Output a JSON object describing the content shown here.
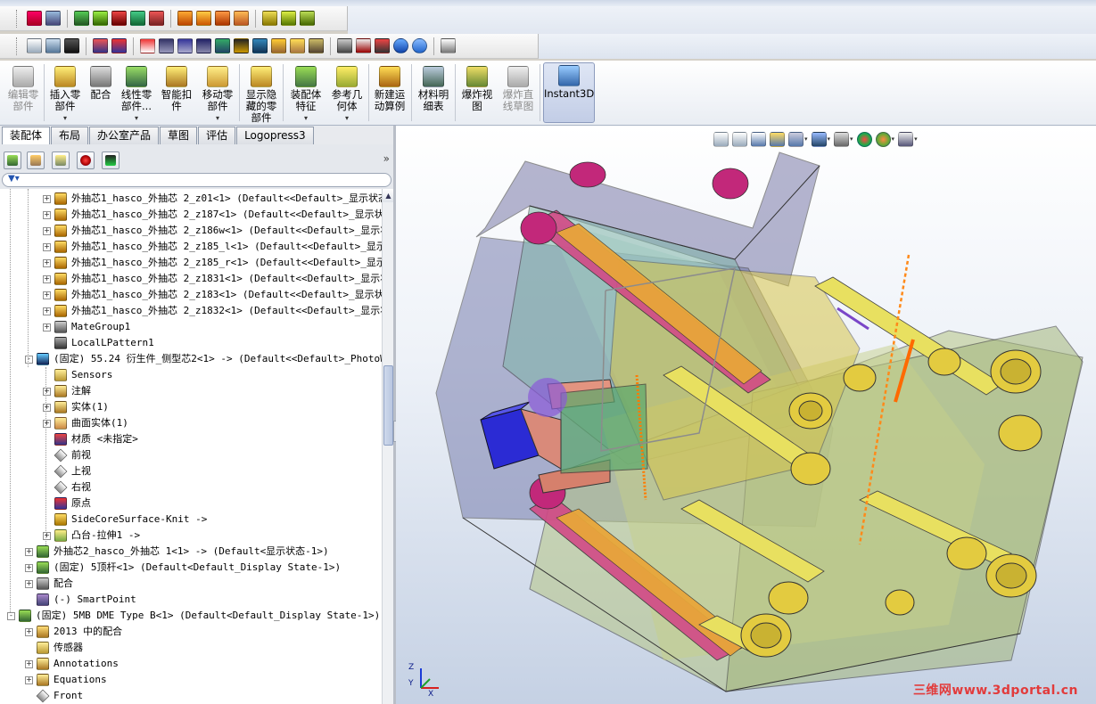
{
  "command_manager": {
    "buttons": [
      {
        "label_lines": [
          "编辑零",
          "部件"
        ],
        "disabled": true
      },
      {
        "label_lines": [
          "插入零",
          "部件"
        ],
        "dropdown": true
      },
      {
        "label_lines": [
          "配合"
        ]
      },
      {
        "label_lines": [
          "线性零",
          "部件..."
        ],
        "dropdown": true
      },
      {
        "label_lines": [
          "智能扣",
          "件"
        ]
      },
      {
        "label_lines": [
          "移动零",
          "部件"
        ],
        "dropdown": true
      },
      {
        "label_lines": [
          "显示隐",
          "藏的零",
          "部件"
        ]
      },
      {
        "label_lines": [
          "装配体",
          "特征"
        ],
        "dropdown": true
      },
      {
        "label_lines": [
          "参考几",
          "何体"
        ],
        "dropdown": true
      },
      {
        "label_lines": [
          "新建运",
          "动算例"
        ]
      },
      {
        "label_lines": [
          "材料明",
          "细表"
        ]
      },
      {
        "label_lines": [
          "爆炸视",
          "图"
        ]
      },
      {
        "label_lines": [
          "爆炸直",
          "线草图"
        ],
        "disabled": true
      },
      {
        "label_lines": [
          "Instant3D"
        ],
        "active": true
      }
    ]
  },
  "tabs": [
    "装配体",
    "布局",
    "办公室产品",
    "草图",
    "评估",
    "Logopress3"
  ],
  "active_tab": "装配体",
  "tree": {
    "rows": [
      {
        "text": "外抽芯1_hasco_外抽芯 2_z01<1> (Default<<Default>_显示状态",
        "level": 3,
        "expand": "+",
        "icon": "part-icon"
      },
      {
        "text": "外抽芯1_hasco_外抽芯 2_z187<1> (Default<<Default>_显示状态",
        "level": 3,
        "expand": "+",
        "icon": "part-icon"
      },
      {
        "text": "外抽芯1_hasco_外抽芯 2_z186w<1> (Default<<Default>_显示状态",
        "level": 3,
        "expand": "+",
        "icon": "part-icon"
      },
      {
        "text": "外抽芯1_hasco_外抽芯 2_z185_l<1> (Default<<Default>_显示状",
        "level": 3,
        "expand": "+",
        "icon": "part-icon"
      },
      {
        "text": "外抽芯1_hasco_外抽芯 2_z185_r<1> (Default<<Default>_显示状",
        "level": 3,
        "expand": "+",
        "icon": "part-icon"
      },
      {
        "text": "外抽芯1_hasco_外抽芯 2_z1831<1> (Default<<Default>_显示状态",
        "level": 3,
        "expand": "+",
        "icon": "part-icon"
      },
      {
        "text": "外抽芯1_hasco_外抽芯 2_z183<1> (Default<<Default>_显示状态",
        "level": 3,
        "expand": "+",
        "icon": "part-icon"
      },
      {
        "text": "外抽芯1_hasco_外抽芯 2_z1832<1> (Default<<Default>_显示状",
        "level": 3,
        "expand": "+",
        "icon": "part-icon"
      },
      {
        "text": "MateGroup1",
        "level": 3,
        "expand": "+",
        "icon": "mate-icon"
      },
      {
        "text": "LocalLPattern1",
        "level": 3,
        "expand": "",
        "icon": "pattern-icon"
      },
      {
        "text": "(固定) 55.24 衍生件_侧型芯2<1> -> (Default<<Default>_PhotoWor",
        "level": 2,
        "expand": "-",
        "icon": "derived-part-icon"
      },
      {
        "text": "Sensors",
        "level": 3,
        "expand": "",
        "icon": "sensor-icon"
      },
      {
        "text": "注解",
        "level": 3,
        "expand": "+",
        "icon": "annotation-icon"
      },
      {
        "text": "实体(1)",
        "level": 3,
        "expand": "+",
        "icon": "solid-body-icon"
      },
      {
        "text": "曲面实体(1)",
        "level": 3,
        "expand": "+",
        "icon": "surface-body-icon"
      },
      {
        "text": "材质 <未指定>",
        "level": 3,
        "expand": "",
        "icon": "material-icon"
      },
      {
        "text": "前视",
        "level": 3,
        "expand": "",
        "icon": "plane-icon"
      },
      {
        "text": "上视",
        "level": 3,
        "expand": "",
        "icon": "plane-icon"
      },
      {
        "text": "右视",
        "level": 3,
        "expand": "",
        "icon": "plane-icon"
      },
      {
        "text": "原点",
        "level": 3,
        "expand": "",
        "icon": "origin-icon"
      },
      {
        "text": "SideCoreSurface-Knit ->",
        "level": 3,
        "expand": "",
        "icon": "knit-icon"
      },
      {
        "text": "凸台-拉伸1 ->",
        "level": 3,
        "expand": "+",
        "icon": "extrude-icon"
      },
      {
        "text": "外抽芯2_hasco_外抽芯 1<1> -> (Default<显示状态-1>)",
        "level": 2,
        "expand": "+",
        "icon": "assembly-icon"
      },
      {
        "text": "(固定) 5顶杆<1> (Default<Default_Display State-1>)",
        "level": 2,
        "expand": "+",
        "icon": "assembly-icon"
      },
      {
        "text": "配合",
        "level": 2,
        "expand": "+",
        "icon": "mate-icon"
      },
      {
        "text": "(-) SmartPoint",
        "level": 2,
        "expand": "",
        "icon": "smartpoint-icon"
      },
      {
        "text": "(固定) 5MB DME Type B<1> (Default<Default_Display State-1>)",
        "level": 1,
        "expand": "-",
        "icon": "assembly-icon"
      },
      {
        "text": "2013 中的配合",
        "level": 2,
        "expand": "+",
        "icon": "history-icon"
      },
      {
        "text": "传感器",
        "level": 2,
        "expand": "",
        "icon": "sensor-icon"
      },
      {
        "text": "Annotations",
        "level": 2,
        "expand": "+",
        "icon": "annotation-icon"
      },
      {
        "text": "Equations",
        "level": 2,
        "expand": "+",
        "icon": "equation-icon"
      },
      {
        "text": "Front",
        "level": 2,
        "expand": "",
        "icon": "plane-icon"
      }
    ]
  },
  "viewport": {
    "watermark": "三维网www.3dportal.cn",
    "triad": {
      "z": "Z",
      "y": "Y",
      "x": "X"
    }
  }
}
